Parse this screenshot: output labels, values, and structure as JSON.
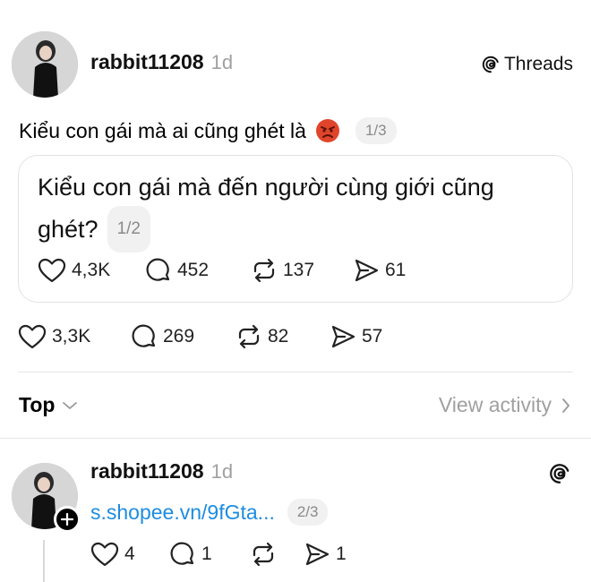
{
  "post1": {
    "username": "rabbit11208",
    "time": "1d",
    "brand": "Threads",
    "text": "Kiểu con gái mà ai cũng ghét là",
    "emoji": "😡",
    "page": "1/3",
    "quote": {
      "text_line1": "Kiểu con gái mà đến người cùng giới cũng",
      "text_line2": "ghét?",
      "page": "1/2",
      "likes": "4,3K",
      "comments": "452",
      "reposts": "137",
      "shares": "61"
    },
    "likes": "3,3K",
    "comments": "269",
    "reposts": "82",
    "shares": "57"
  },
  "replies": {
    "sort_label": "Top",
    "view_activity": "View activity"
  },
  "post2": {
    "username": "rabbit11208",
    "time": "1d",
    "link": "s.shopee.vn/9fGta...",
    "page": "2/3",
    "likes": "4",
    "comments": "1",
    "reposts": "",
    "shares": "1"
  },
  "colors": {
    "link": "#1d8ce0",
    "muted": "#a0a0a0",
    "emoji": "#e0452b"
  },
  "icons": [
    "threads-icon",
    "heart-icon",
    "comment-icon",
    "repost-icon",
    "share-icon",
    "chevron-down-icon",
    "chevron-right-icon",
    "plus-icon"
  ]
}
